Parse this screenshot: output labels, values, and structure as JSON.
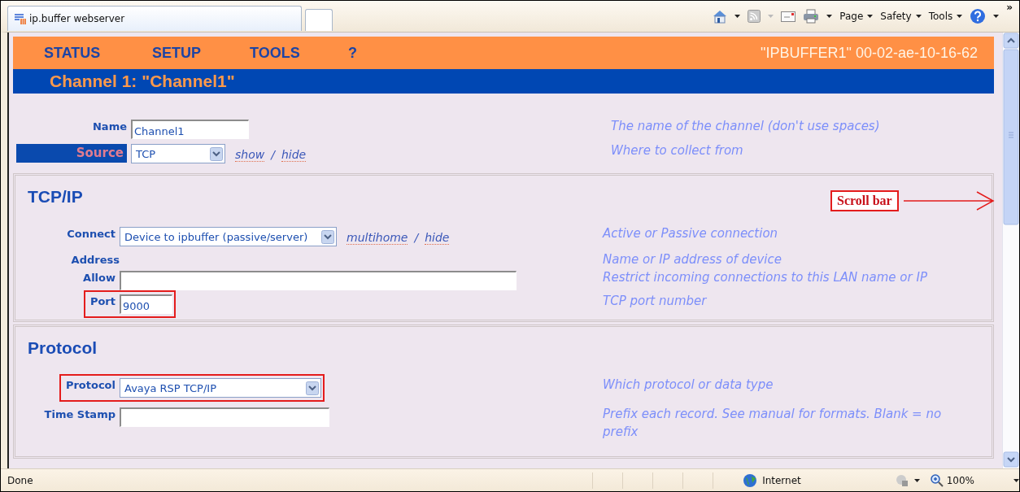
{
  "browser": {
    "tab_title": "ip.buffer webserver",
    "commands": [
      "Page",
      "Safety",
      "Tools"
    ],
    "overflow": "»"
  },
  "nav": {
    "items": [
      "STATUS",
      "SETUP",
      "TOOLS",
      "?"
    ],
    "device": "\"IPBUFFER1\" 00-02-ae-10-16-62"
  },
  "channel_title": "Channel 1: \"Channel1\"",
  "fields": [
    {
      "kind": "text",
      "label": "Name",
      "label_active": false,
      "value": "Channel1",
      "hint": "The name of the channel (don't use spaces)",
      "highlighted": false
    },
    {
      "kind": "select",
      "label": "Source",
      "label_active": true,
      "value": "TCP",
      "links": [
        "show",
        "hide"
      ],
      "link_separator": "/",
      "hint": "Where to collect from",
      "highlighted": false
    }
  ],
  "sections": [
    {
      "title": "TCP/IP",
      "fields": [
        {
          "kind": "select",
          "label": "Connect",
          "label_active": false,
          "value": "Device to ipbuffer (passive/server)",
          "links": [
            "multihome",
            "hide"
          ],
          "link_separator": "/",
          "hint": "Active or Passive connection",
          "highlighted": false
        },
        {
          "kind": "heading",
          "label": "Address",
          "label_active": false,
          "hint": "Name or IP address of device",
          "highlighted": false
        },
        {
          "kind": "text",
          "label": "Allow",
          "label_active": false,
          "hint": "Restrict incoming connections to this LAN name or IP",
          "highlighted": false
        },
        {
          "kind": "text",
          "label": "Port",
          "label_active": false,
          "value": "9000",
          "hint": "TCP port number",
          "highlighted": true
        }
      ]
    },
    {
      "title": "Protocol",
      "fields": [
        {
          "kind": "select",
          "label": "Protocol",
          "label_active": false,
          "value": "Avaya RSP TCP/IP",
          "hint": "Which protocol or data type",
          "highlighted": true
        },
        {
          "kind": "text",
          "label": "Time Stamp",
          "label_active": false,
          "hint": "Prefix each record. See manual for formats. Blank = no prefix",
          "highlighted": false
        }
      ]
    }
  ],
  "annotation": {
    "text": "Scroll bar"
  },
  "status_bar": {
    "text": "Done",
    "zone": "Internet",
    "zoom": "100%"
  }
}
